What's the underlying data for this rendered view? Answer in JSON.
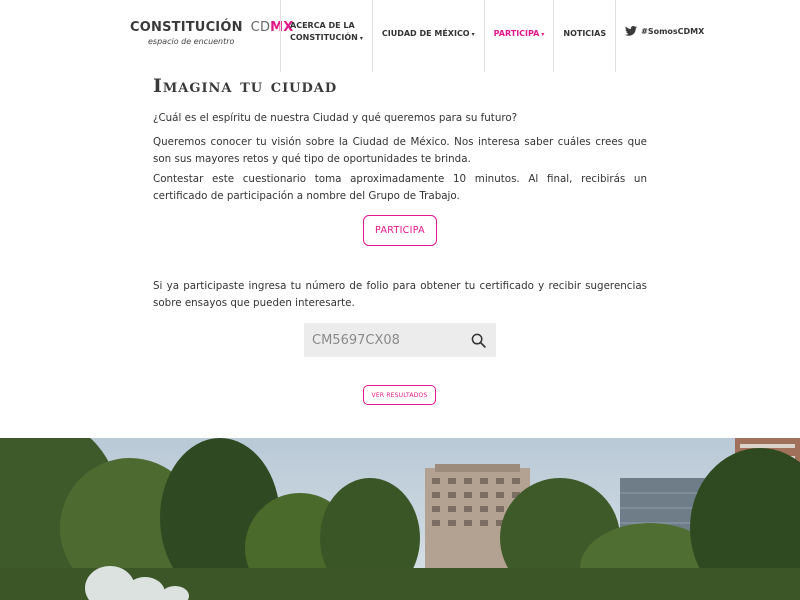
{
  "header": {
    "logo": {
      "name": "CONSTITUCIÓN",
      "cd": "CD",
      "mx": "MX",
      "tagline": "espacio de encuentro"
    },
    "nav": [
      {
        "line1": "ACERCA DE LA",
        "line2": "CONSTITUCIÓN",
        "has_dropdown": true,
        "active": false
      },
      {
        "label": "CIUDAD DE MÉXICO",
        "has_dropdown": true,
        "active": false
      },
      {
        "label": "PARTICIPA",
        "has_dropdown": true,
        "active": true
      },
      {
        "label": "NOTICIAS",
        "has_dropdown": false,
        "active": false
      },
      {
        "label": "#SomosCDMX",
        "icon": "twitter-icon"
      }
    ]
  },
  "main": {
    "title": "Imagina tu ciudad",
    "paragraph1": "¿Cuál es el espíritu de nuestra Ciudad y qué queremos para su futuro?",
    "paragraph2": "Queremos conocer tu visión sobre la Ciudad de México. Nos interesa saber cuáles crees que son sus mayores retos y qué tipo de oportunidades te brinda.",
    "paragraph3": "Contestar este cuestionario toma aproximadamente 10 minutos. Al final, recibirás un certificado de participación a nombre del Grupo de Trabajo.",
    "participa_button": "PARTICIPA",
    "paragraph4": "Si ya participaste ingresa tu número de folio para obtener tu certificado y recibir sugerencias sobre ensayos que pueden interesarte.",
    "search": {
      "placeholder": "CM5697CX08",
      "value": "",
      "icon": "search-icon"
    },
    "results_button": "VER RESULTADOS"
  },
  "colors": {
    "accent": "#e3178c",
    "text": "#333333",
    "search_bg": "#ececec"
  }
}
